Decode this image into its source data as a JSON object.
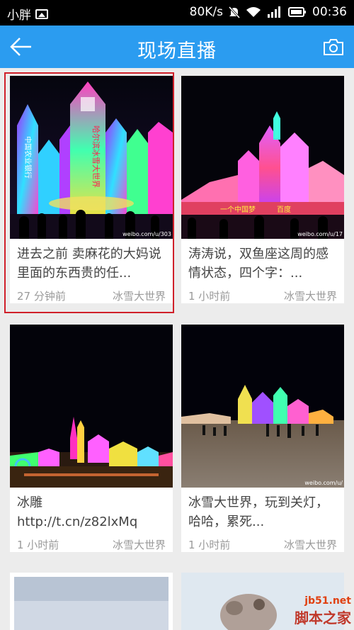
{
  "status_bar": {
    "carrier": "小胖",
    "speed": "80K/s",
    "time": "00:36"
  },
  "header": {
    "title": "现场直播"
  },
  "cards": [
    {
      "text": "进去之前 卖麻花的大妈说里面的东西贵的任...",
      "time": "27 分钟前",
      "source": "冰雪大世界"
    },
    {
      "text": "涛涛说，双鱼座这周的感情状态，四个字：...",
      "time": "1 小时前",
      "source": "冰雪大世界"
    },
    {
      "text": "冰雕 http://t.cn/z82lxMq",
      "time": "1 小时前",
      "source": "冰雪大世界"
    },
    {
      "text": "冰雪大世界，玩到关灯，哈哈，累死...",
      "time": "1 小时前",
      "source": "冰雪大世界"
    }
  ],
  "image_signs": {
    "card1_banner": "哈尔滨冰雪大世界",
    "card1_side": "中国农业银行",
    "card2_banner1": "一个中国梦",
    "card2_banner2": "百度"
  },
  "image_credits": [
    "weibo.com/u/303",
    "weibo.com/u/17",
    "weibo.com/u/"
  ],
  "watermark": {
    "site": "jb51.net",
    "name": "脚本之家"
  }
}
